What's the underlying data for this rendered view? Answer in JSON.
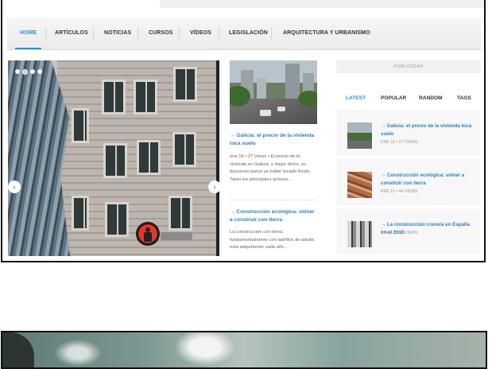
{
  "nav": {
    "items": [
      {
        "label": "HOME",
        "active": true
      },
      {
        "label": "ARTÍCULOS"
      },
      {
        "label": "NOTICIAS"
      },
      {
        "label": "CURSOS"
      },
      {
        "label": "VÍDEOS"
      },
      {
        "label": "LEGISLACIÓN"
      },
      {
        "label": "ARQUITECTURA Y URBANISMO"
      }
    ]
  },
  "slider": {
    "prev_label": "‹",
    "next_label": "›",
    "slide_count": 4,
    "active_slide": 1
  },
  "posts": [
    {
      "title": "→ Galicia: el precio de la vivienda toca suelo",
      "meta": "ene 18 • 27 Views • El precio de la vivienda en Galicia, o mejor dicho, su descenso parce ya haber tocado fondo. Tanto los principales actores…"
    },
    {
      "title": "→ Construcción ecológica: volver a construir con tierra",
      "meta": "La construcción con tierra, fundamentalmente con ladrillos de adobe, está adquiriendo cada año…"
    }
  ],
  "sidebar": {
    "ad_label": "PUBLICIDAD",
    "tabs": [
      {
        "label": "LATEST",
        "active": true
      },
      {
        "label": "POPULAR"
      },
      {
        "label": "RANDOM"
      },
      {
        "label": "TAGS"
      }
    ],
    "items": [
      {
        "title": "→ Galicia: el precio de la vivienda toca suelo",
        "meta": "ENE 18 • 27 VIEWS"
      },
      {
        "title": "→ Construcción ecológica: volver a construir con tierra",
        "meta": "ENE 15 • 44 VIEWS"
      },
      {
        "title": "→ La construcción crecerá en España en el 2015",
        "meta": "ENE 13 • 66 VIEWS"
      }
    ]
  },
  "colors": {
    "accent": "#2a8fd4",
    "link": "#2a7fc0",
    "traffic_light": "#e3362b"
  }
}
